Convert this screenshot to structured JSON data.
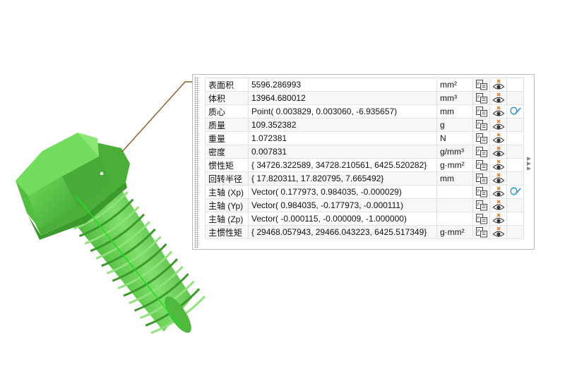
{
  "rows": [
    {
      "name": "表面积",
      "value": "5596.286993",
      "unit": "mm²",
      "has_sweep": false
    },
    {
      "name": "体积",
      "value": "13964.680012",
      "unit": "mm³",
      "has_sweep": false
    },
    {
      "name": "质心",
      "value": "Point( 0.003829, 0.003060, -6.935657)",
      "unit": "mm",
      "has_sweep": true
    },
    {
      "name": "质量",
      "value": "109.352382",
      "unit": "g",
      "has_sweep": false
    },
    {
      "name": "重量",
      "value": "1.072381",
      "unit": "N",
      "has_sweep": false
    },
    {
      "name": "密度",
      "value": "0.007831",
      "unit": "g/mm³",
      "has_sweep": false
    },
    {
      "name": "惯性矩",
      "value": "{ 34726.322589, 34728.210561, 6425.520282}",
      "unit": "g·mm²",
      "has_sweep": false
    },
    {
      "name": "回转半径",
      "value": "{ 17.820311, 17.820795, 7.665492}",
      "unit": "mm",
      "has_sweep": false
    },
    {
      "name": "主轴 (Xp)",
      "value": "Vector( 0.177973, 0.984035, -0.000029)",
      "unit": "",
      "has_sweep": true
    },
    {
      "name": "主轴 (Yp)",
      "value": "Vector( 0.984035, -0.177973, -0.000111)",
      "unit": "",
      "has_sweep": false
    },
    {
      "name": "主轴 (Zp)",
      "value": "Vector( -0.000115, -0.000009, -1.000000)",
      "unit": "",
      "has_sweep": false
    },
    {
      "name": "主惯性矩",
      "value": "{ 29468.057943, 29466.043223, 6425.517349}",
      "unit": "g·mm²",
      "has_sweep": false
    }
  ],
  "icons": {
    "col1": "expression-copy-icon",
    "col2": "visibility-eye-icon",
    "col3": "sweep-curve-icon"
  },
  "colors": {
    "bolt": "#5cc94a",
    "axis_line": "#22dd22",
    "leader": "#8b5a2b"
  }
}
